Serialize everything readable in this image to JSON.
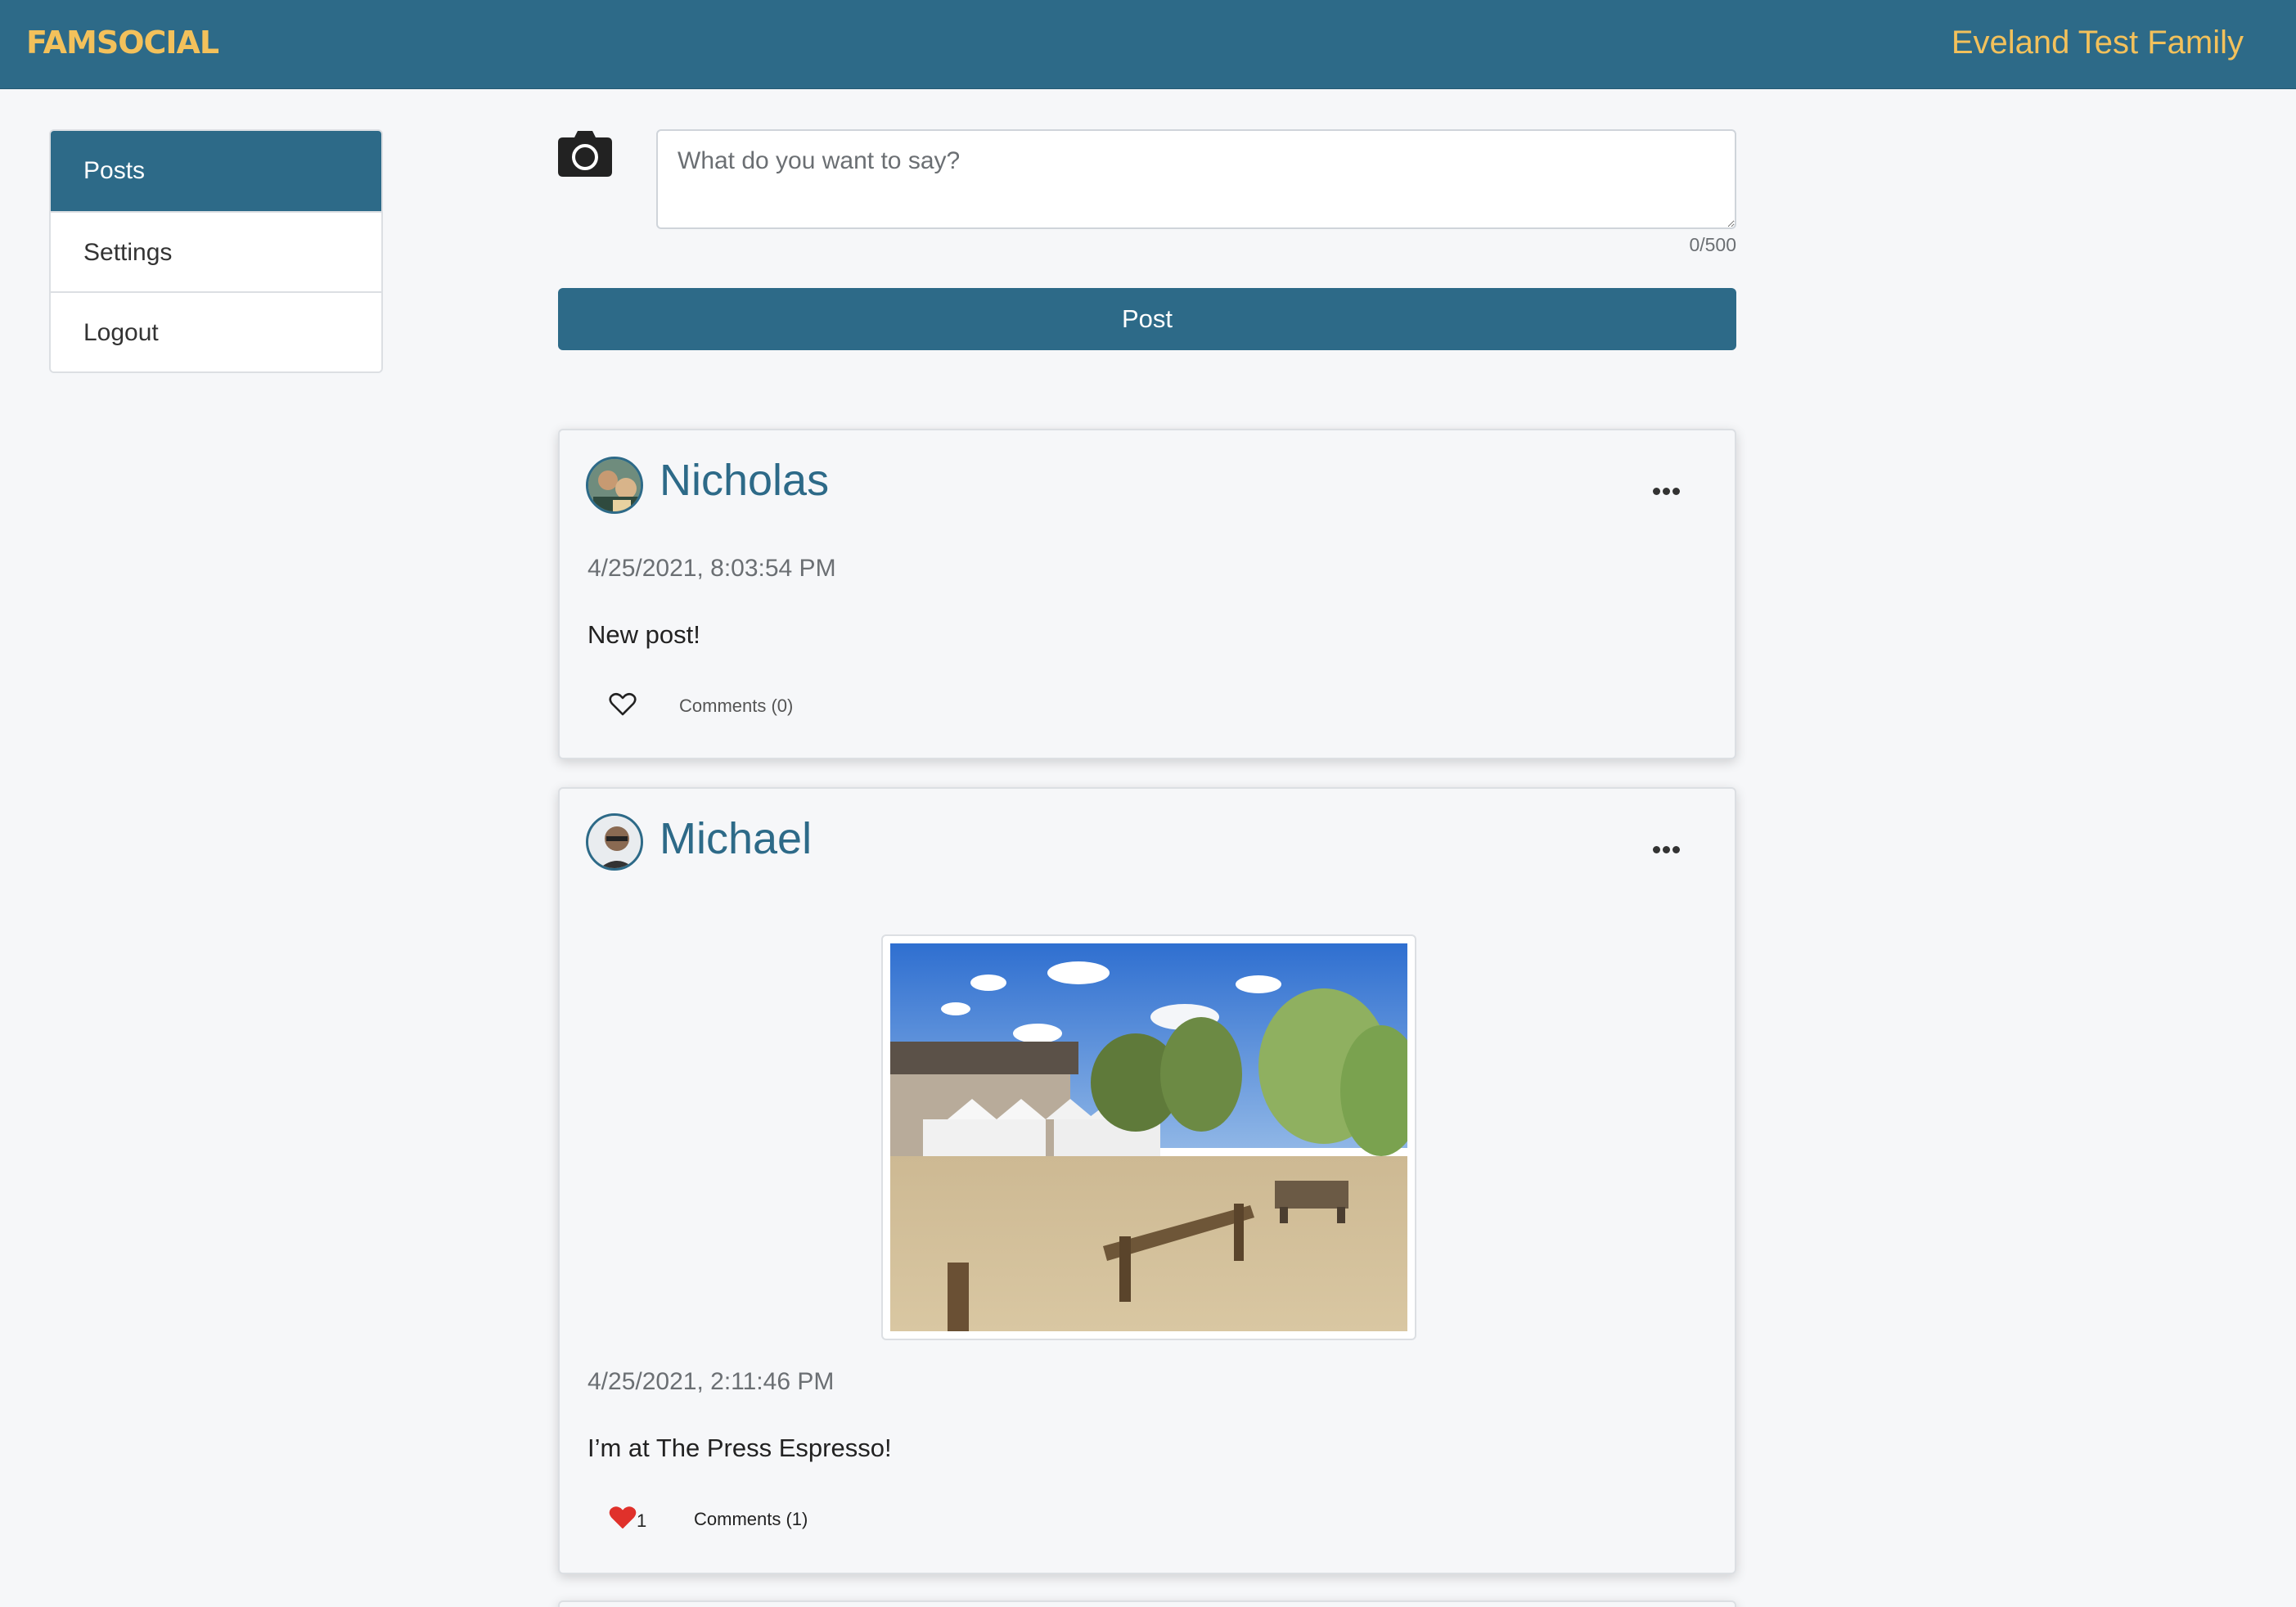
{
  "header": {
    "brand": "FAMSOCIAL",
    "family_name": "Eveland Test Family",
    "brand_color": "#f3c15b",
    "bar_color": "#2d6a88"
  },
  "sidebar": {
    "items": [
      {
        "label": "Posts",
        "active": true
      },
      {
        "label": "Settings",
        "active": false
      },
      {
        "label": "Logout",
        "active": false
      }
    ]
  },
  "composer": {
    "camera_icon": "camera-icon",
    "placeholder": "What do you want to say?",
    "value": "",
    "counter": "0/500",
    "post_label": "Post"
  },
  "posts": [
    {
      "author": "Nicholas",
      "timestamp": "4/25/2021, 8:03:54 PM",
      "text": "New post!",
      "liked": false,
      "like_count": "",
      "comments_label": "Comments (0)",
      "has_photo": false
    },
    {
      "author": "Michael",
      "timestamp": "4/25/2021, 2:11:46 PM",
      "text": "I’m at The Press Espresso!",
      "liked": true,
      "like_count": "1",
      "comments_label": "Comments (1)",
      "has_photo": true,
      "like_color": "#e0312b"
    }
  ]
}
